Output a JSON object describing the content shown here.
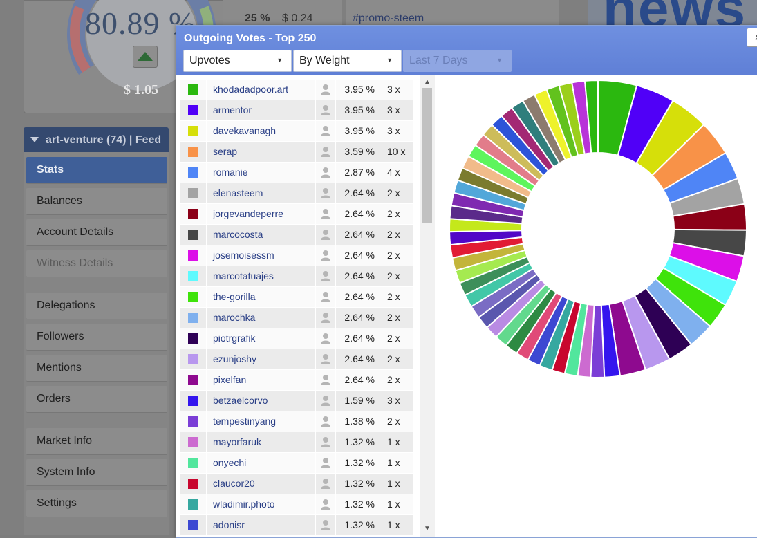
{
  "background": {
    "gauge": {
      "percent": "80.89 %",
      "value": "$ 1.05",
      "level": 0.8089
    },
    "table_snippet": {
      "percent": "25 %",
      "usd": "$ 0.24"
    },
    "tag": "#promo-steem",
    "news_text": "news"
  },
  "sidebar": {
    "header": "art-venture (74)  |  Feed",
    "items": [
      {
        "label": "Stats",
        "state": "active"
      },
      {
        "label": "Balances",
        "state": "normal"
      },
      {
        "label": "Account Details",
        "state": "normal"
      },
      {
        "label": "Witness Details",
        "state": "disabled"
      },
      {
        "label": "Delegations",
        "state": "normal"
      },
      {
        "label": "Followers",
        "state": "normal"
      },
      {
        "label": "Mentions",
        "state": "normal"
      },
      {
        "label": "Orders",
        "state": "normal"
      },
      {
        "label": "Market Info",
        "state": "normal"
      },
      {
        "label": "System Info",
        "state": "normal"
      },
      {
        "label": "Settings",
        "state": "normal"
      }
    ]
  },
  "modal": {
    "title": "Outgoing Votes - Top 250",
    "close_label": "x",
    "filters": {
      "type": "Upvotes",
      "sort": "By Weight",
      "period": "Last 7 Days"
    },
    "icons": {
      "dropdown": "triangle-down-icon",
      "user": "user-icon",
      "scroll_up": "chevron-up-icon",
      "scroll_down": "chevron-down-icon"
    },
    "rows": [
      {
        "color": "#2bb80f",
        "name": "khodadadpoor.art",
        "pct": "3.95 %",
        "count": "3 x"
      },
      {
        "color": "#5000f7",
        "name": "armentor",
        "pct": "3.95 %",
        "count": "3 x"
      },
      {
        "color": "#d6df0a",
        "name": "davekavanagh",
        "pct": "3.95 %",
        "count": "3 x"
      },
      {
        "color": "#f89248",
        "name": "serap",
        "pct": "3.59 %",
        "count": "10 x"
      },
      {
        "color": "#4f85f6",
        "name": "romanie",
        "pct": "2.87 %",
        "count": "4 x"
      },
      {
        "color": "#a3a3a3",
        "name": "elenasteem",
        "pct": "2.64 %",
        "count": "2 x"
      },
      {
        "color": "#8b0017",
        "name": "jorgevandeperre",
        "pct": "2.64 %",
        "count": "2 x"
      },
      {
        "color": "#474747",
        "name": "marcocosta",
        "pct": "2.64 %",
        "count": "2 x"
      },
      {
        "color": "#dc0fe8",
        "name": "josemoisessm",
        "pct": "2.64 %",
        "count": "2 x"
      },
      {
        "color": "#5efafe",
        "name": "marcotatuajes",
        "pct": "2.64 %",
        "count": "2 x"
      },
      {
        "color": "#3fe30b",
        "name": "the-gorilla",
        "pct": "2.64 %",
        "count": "2 x"
      },
      {
        "color": "#7fb0ee",
        "name": "marochka",
        "pct": "2.64 %",
        "count": "2 x"
      },
      {
        "color": "#2e0055",
        "name": "piotrgrafik",
        "pct": "2.64 %",
        "count": "2 x"
      },
      {
        "color": "#b897ee",
        "name": "ezunjoshy",
        "pct": "2.64 %",
        "count": "2 x"
      },
      {
        "color": "#8e0a8f",
        "name": "pixelfan",
        "pct": "2.64 %",
        "count": "2 x"
      },
      {
        "color": "#3415ee",
        "name": "betzaelcorvo",
        "pct": "1.59 %",
        "count": "3 x"
      },
      {
        "color": "#7b3ed6",
        "name": "tempestinyang",
        "pct": "1.38 %",
        "count": "2 x"
      },
      {
        "color": "#cc6bd0",
        "name": "mayorfaruk",
        "pct": "1.32 %",
        "count": "1 x"
      },
      {
        "color": "#52e69d",
        "name": "onyechi",
        "pct": "1.32 %",
        "count": "1 x"
      },
      {
        "color": "#c8062e",
        "name": "claucor20",
        "pct": "1.32 %",
        "count": "1 x"
      },
      {
        "color": "#36a8a0",
        "name": "wladimir.photo",
        "pct": "1.32 %",
        "count": "1 x"
      },
      {
        "color": "#3d48d2",
        "name": "adonisr",
        "pct": "1.32 %",
        "count": "1 x"
      }
    ]
  },
  "chart_data": {
    "type": "pie",
    "style": "donut",
    "values": [
      3.95,
      3.95,
      3.95,
      3.59,
      2.87,
      2.64,
      2.64,
      2.64,
      2.64,
      2.64,
      2.64,
      2.64,
      2.64,
      2.64,
      2.64,
      1.59,
      1.38,
      1.32,
      1.32,
      1.32,
      1.32,
      1.32,
      1.32,
      1.32,
      1.32,
      1.32,
      1.32,
      1.32,
      1.32,
      1.32,
      1.32,
      1.32,
      1.32,
      1.32,
      1.32,
      1.32,
      1.32,
      1.32,
      1.32,
      1.32,
      1.32,
      1.32,
      1.32,
      1.32,
      1.32,
      1.32,
      1.32,
      1.32,
      1.32,
      1.32,
      1.32,
      1.32
    ],
    "colors": [
      "#2bb80f",
      "#5000f7",
      "#d6df0a",
      "#f89248",
      "#4f85f6",
      "#a3a3a3",
      "#8b0017",
      "#474747",
      "#dc0fe8",
      "#5efafe",
      "#3fe30b",
      "#7fb0ee",
      "#2e0055",
      "#b897ee",
      "#8e0a8f",
      "#3415ee",
      "#7b3ed6",
      "#cc6bd0",
      "#52e69d",
      "#c8062e",
      "#36a8a0",
      "#3d48d2",
      "#e04a78",
      "#2e8a43",
      "#62d98d",
      "#b98be3",
      "#5a57ae",
      "#7a6cc4",
      "#42c7a7",
      "#3d8f5a",
      "#a5ea50",
      "#c3b53a",
      "#e11b34",
      "#5207c7",
      "#c4e81b",
      "#5b2a8a",
      "#7f29b1",
      "#52a7d9",
      "#7b7b2e",
      "#f1bb8a",
      "#5ef55d",
      "#e27c8a",
      "#cdbc5a",
      "#2c54d8",
      "#a32874",
      "#2f7e7c",
      "#8c7b6e",
      "#eef22b",
      "#62c21d",
      "#9bcf1b",
      "#b833d8"
    ]
  }
}
